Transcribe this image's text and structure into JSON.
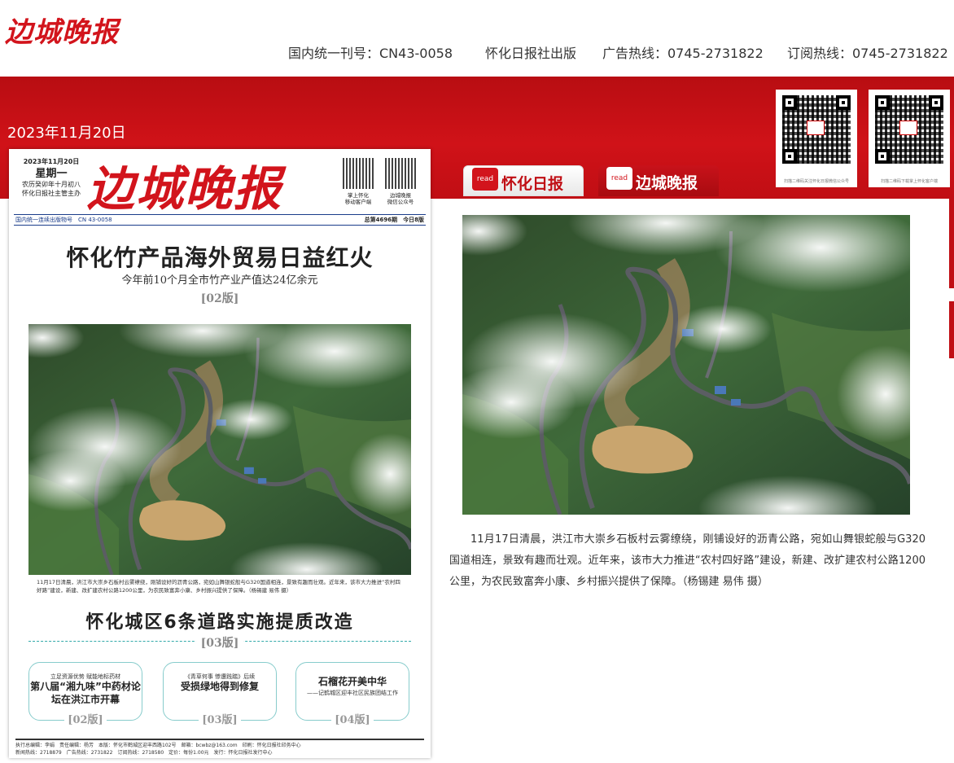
{
  "header": {
    "logo": "边城晚报",
    "issn": "国内统一刊号：CN43-0058",
    "publisher": "怀化日报社出版",
    "ad_hotline": "广告热线：0745-2731822",
    "subscribe_hotline": "订阅热线：0745-2731822"
  },
  "band": {
    "date": "2023年11月20日",
    "qr_codes": [
      {
        "icon": "qr-code-icon",
        "caption": "扫描二维码关注怀化日报微信公众号"
      },
      {
        "icon": "qr-code-icon",
        "caption": "扫描二维码下载掌上怀化客户端"
      }
    ]
  },
  "tabs": [
    {
      "badge": "read",
      "label": "怀化日报"
    },
    {
      "badge": "read",
      "label": "边城晚报"
    }
  ],
  "paper": {
    "date_line": "2023年11月20日",
    "weekday": "星期一",
    "lunar_line": "农历癸卯年十月初八",
    "sponsor_line": "怀化日报社主管主办",
    "masthead": "边城晚报",
    "qr1_caption": "掌上怀化\n移动客户端",
    "qr2_caption": "边城晚报\n微信公众号",
    "strip_left": "国内统一连续出版物号　CN 43-0058",
    "strip_right": "总第4696期　今日8版",
    "headline1": "怀化竹产品海外贸易日益红火",
    "sub1": "今年前10个月全市竹产业产值达24亿余元",
    "ver1": "[02版]",
    "photo_caption": "11月17日清晨，洪江市大崇乡石板村云雾缭绕，刚铺设好的沥青公路，宛如山舞银蛇般与G320国道相连，景致有趣而壮观。近年来，该市大力推进“农村四好路”建设，新建、改扩建农村公路1200公里，为农民致富奔小康、乡村振兴提供了保障。（杨锡建 易伟 摄）",
    "headline2": "怀化城区6条道路实施提质改造",
    "ver2": "[03版]",
    "boxes": [
      {
        "kicker": "立足资源优势 赋能地标药材",
        "title": "第八届“湘九味”中药材论坛在洪江市开幕",
        "ver": "[02版]"
      },
      {
        "kicker": "《青草何事 惨遭践踏》后续",
        "title": "受损绿地得到修复",
        "ver": "[03版]"
      },
      {
        "kicker": "",
        "title": "石榴花开美中华",
        "sub": "——记鹤城区迎丰社区民族团结工作",
        "ver": "[04版]"
      }
    ],
    "footer_line1": "执行总编辑：李娟　责任编辑：杨芳　本版：怀化市鹤城区迎丰西路102号　邮箱：bcwbz@163.com　印刷：怀化日报社印务中心",
    "footer_line2": "新闻热线：2718879　广告热线：2731822　订阅热线：2718580　定价：每份1.00元　发行：怀化日报社发行中心"
  },
  "main": {
    "caption": "11月17日清晨，洪江市大崇乡石板村云雾缭绕，刚铺设好的沥青公路，宛如山舞银蛇般与G320国道相连，景致有趣而壮观。近年来，该市大力推进“农村四好路”建设，新建、改扩建农村公路1200公里，为农民致富奔小康、乡村振兴提供了保障。（杨锡建 易伟 摄）"
  }
}
